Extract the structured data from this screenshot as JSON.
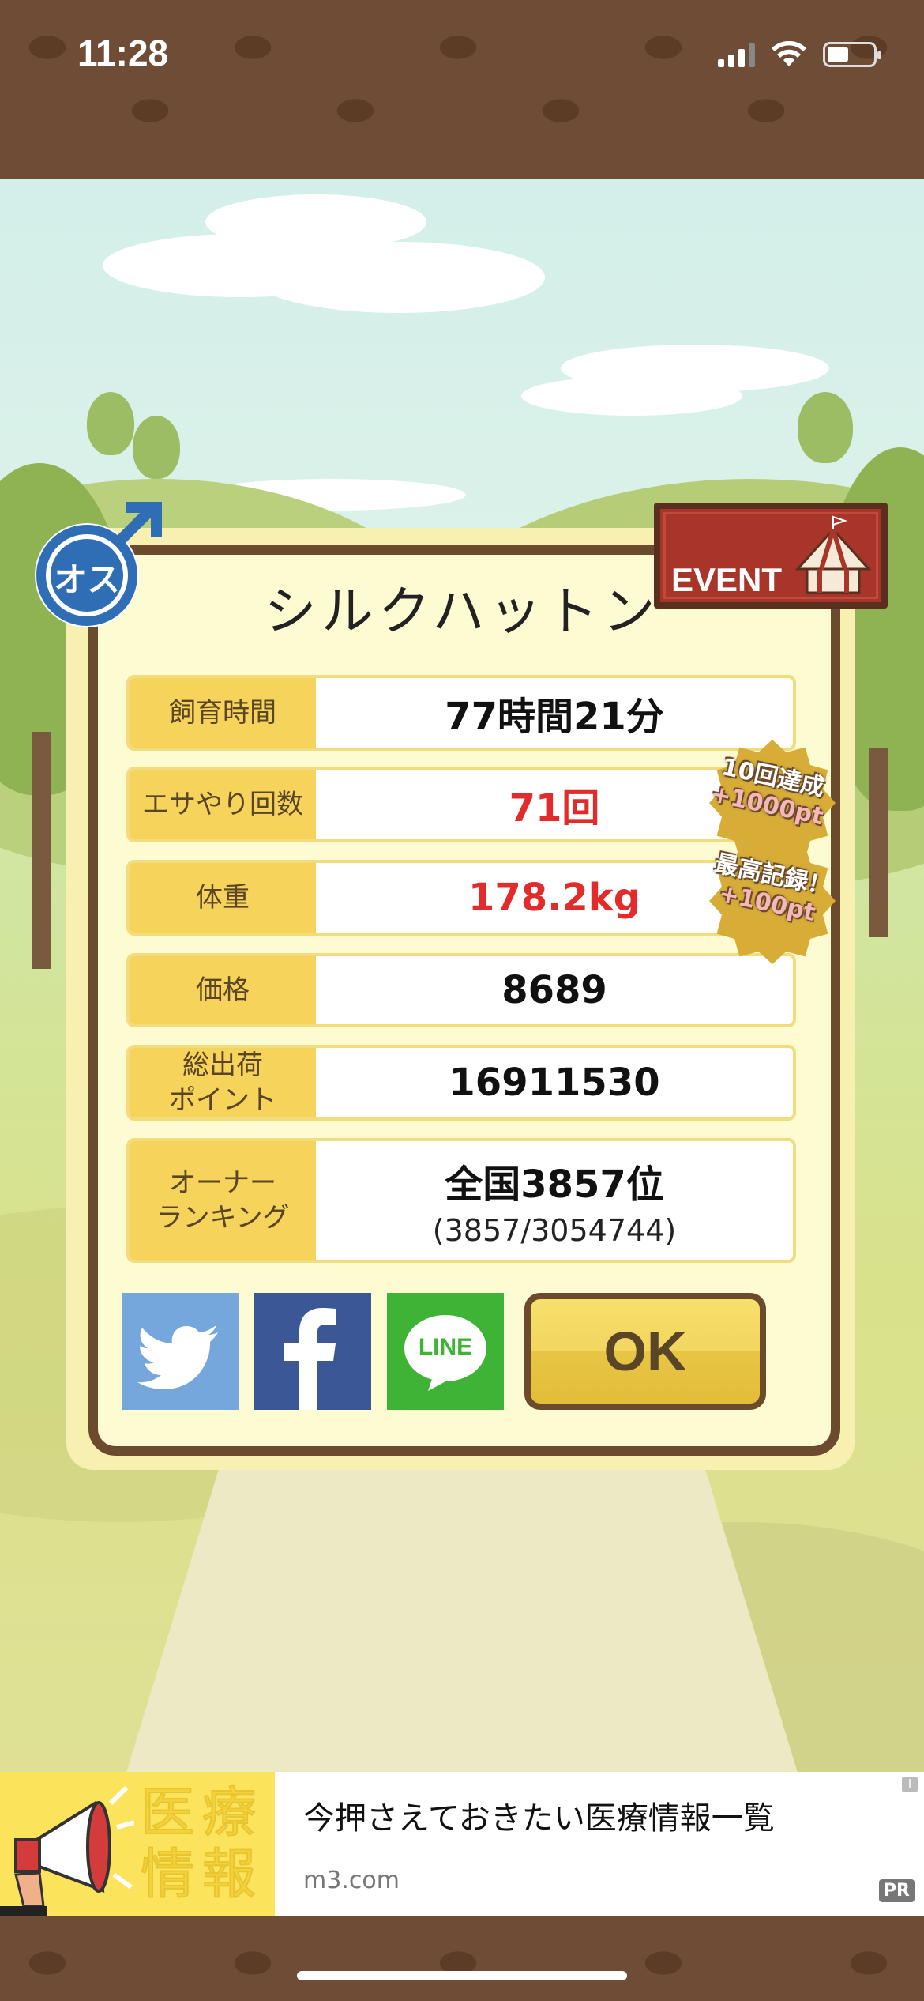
{
  "status_bar": {
    "time": "11:28"
  },
  "dialog": {
    "pig_name": "シルクハットン",
    "gender_label": "オス",
    "event_label": "EVENT",
    "stats": [
      {
        "label": "飼育時間",
        "value": "77時間21分",
        "highlight": false
      },
      {
        "label": "エサやり回数",
        "value": "71回",
        "highlight": true
      },
      {
        "label": "体重",
        "value": "178.2kg",
        "highlight": true
      },
      {
        "label": "価格",
        "value": "8689",
        "highlight": false
      },
      {
        "label": "総出荷\nポイント",
        "value": "16911530",
        "highlight": false
      },
      {
        "label": "オーナー\nランキング",
        "value": "全国3857位",
        "sub": "(3857/3054744)",
        "highlight": false
      }
    ],
    "bonuses": [
      {
        "title": "10回達成",
        "points": "+1000pt"
      },
      {
        "title": "最高記録！",
        "points": "+100pt"
      }
    ],
    "share_buttons": {
      "twitter": "twitter-icon",
      "facebook": "facebook-icon",
      "line_label": "LINE"
    },
    "ok_label": "OK"
  },
  "ad": {
    "image_text": "医療\n情報",
    "title": "今押さえておきたい医療情報一覧",
    "domain": "m3.com",
    "pr": "PR",
    "info": "i"
  },
  "colors": {
    "accent_yellow": "#f6d35a",
    "highlight_red": "#e22b2b",
    "frame_brown": "#6b4a2e",
    "twitter": "#75a7dd",
    "facebook": "#3c5795",
    "line": "#3fb335"
  }
}
